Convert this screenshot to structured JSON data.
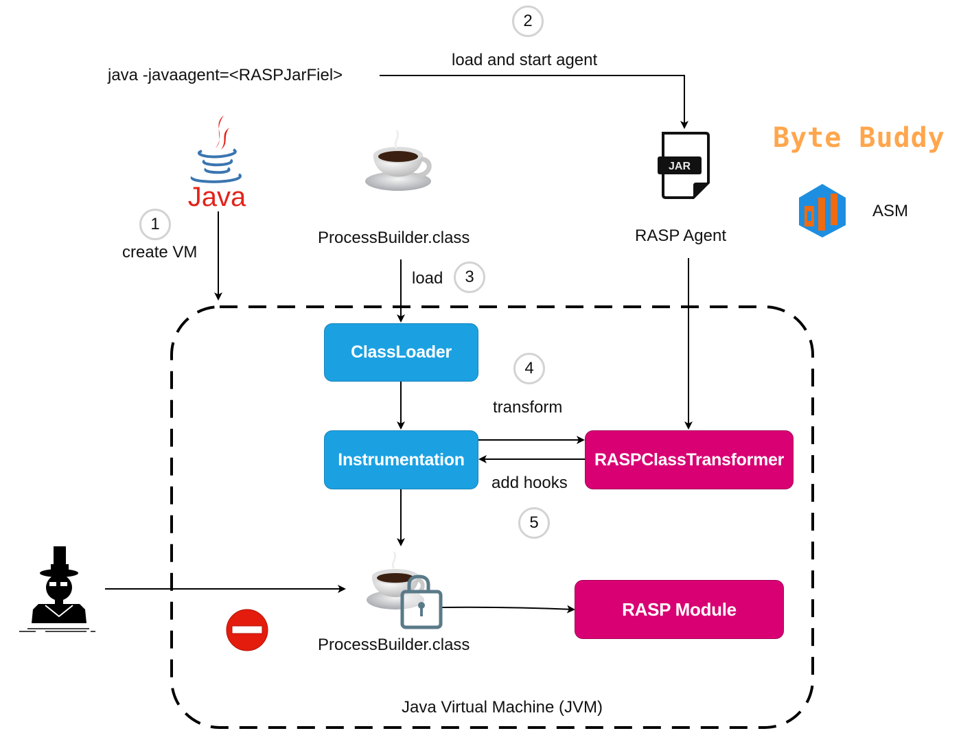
{
  "labels": {
    "javaagent_cmd": "java -javaagent=<RASPJarFiel>",
    "load_and_start_agent": "load and start agent",
    "create_vm": "create VM",
    "processbuilder_top": "ProcessBuilder.class",
    "rasp_agent": "RASP Agent",
    "load": "load",
    "transform": "transform",
    "add_hooks": "add hooks",
    "processbuilder_bottom": "ProcessBuilder.class",
    "jvm": "Java Virtual Machine (JVM)",
    "asm": "ASM",
    "bytebuddy": "Byte Buddy",
    "java_logo_text": "Java",
    "jar_text": "JAR"
  },
  "steps": [
    "1",
    "2",
    "3",
    "4",
    "5"
  ],
  "boxes": {
    "classloader": "ClassLoader",
    "instrumentation": "Instrumentation",
    "transformer": "RASPClassTransformer",
    "rasp_module": "RASP Module"
  },
  "icons": {
    "java_logo": "java-logo-icon",
    "coffee_cup": "coffee-cup-icon",
    "jar_file": "jar-file-icon",
    "asm_logo": "asm-logo-icon",
    "hacker": "hacker-icon",
    "no_entry": "no-entry-icon",
    "lock": "lock-icon"
  },
  "colors": {
    "blue_box": "#1ba1e2",
    "pink_box": "#d80073",
    "java_red": "#e2231a",
    "java_blue": "#3a75b0",
    "bytebuddy_orange": "#ffa64d",
    "no_entry_red": "#e31c0e",
    "lock_gray": "#5a7a89"
  }
}
